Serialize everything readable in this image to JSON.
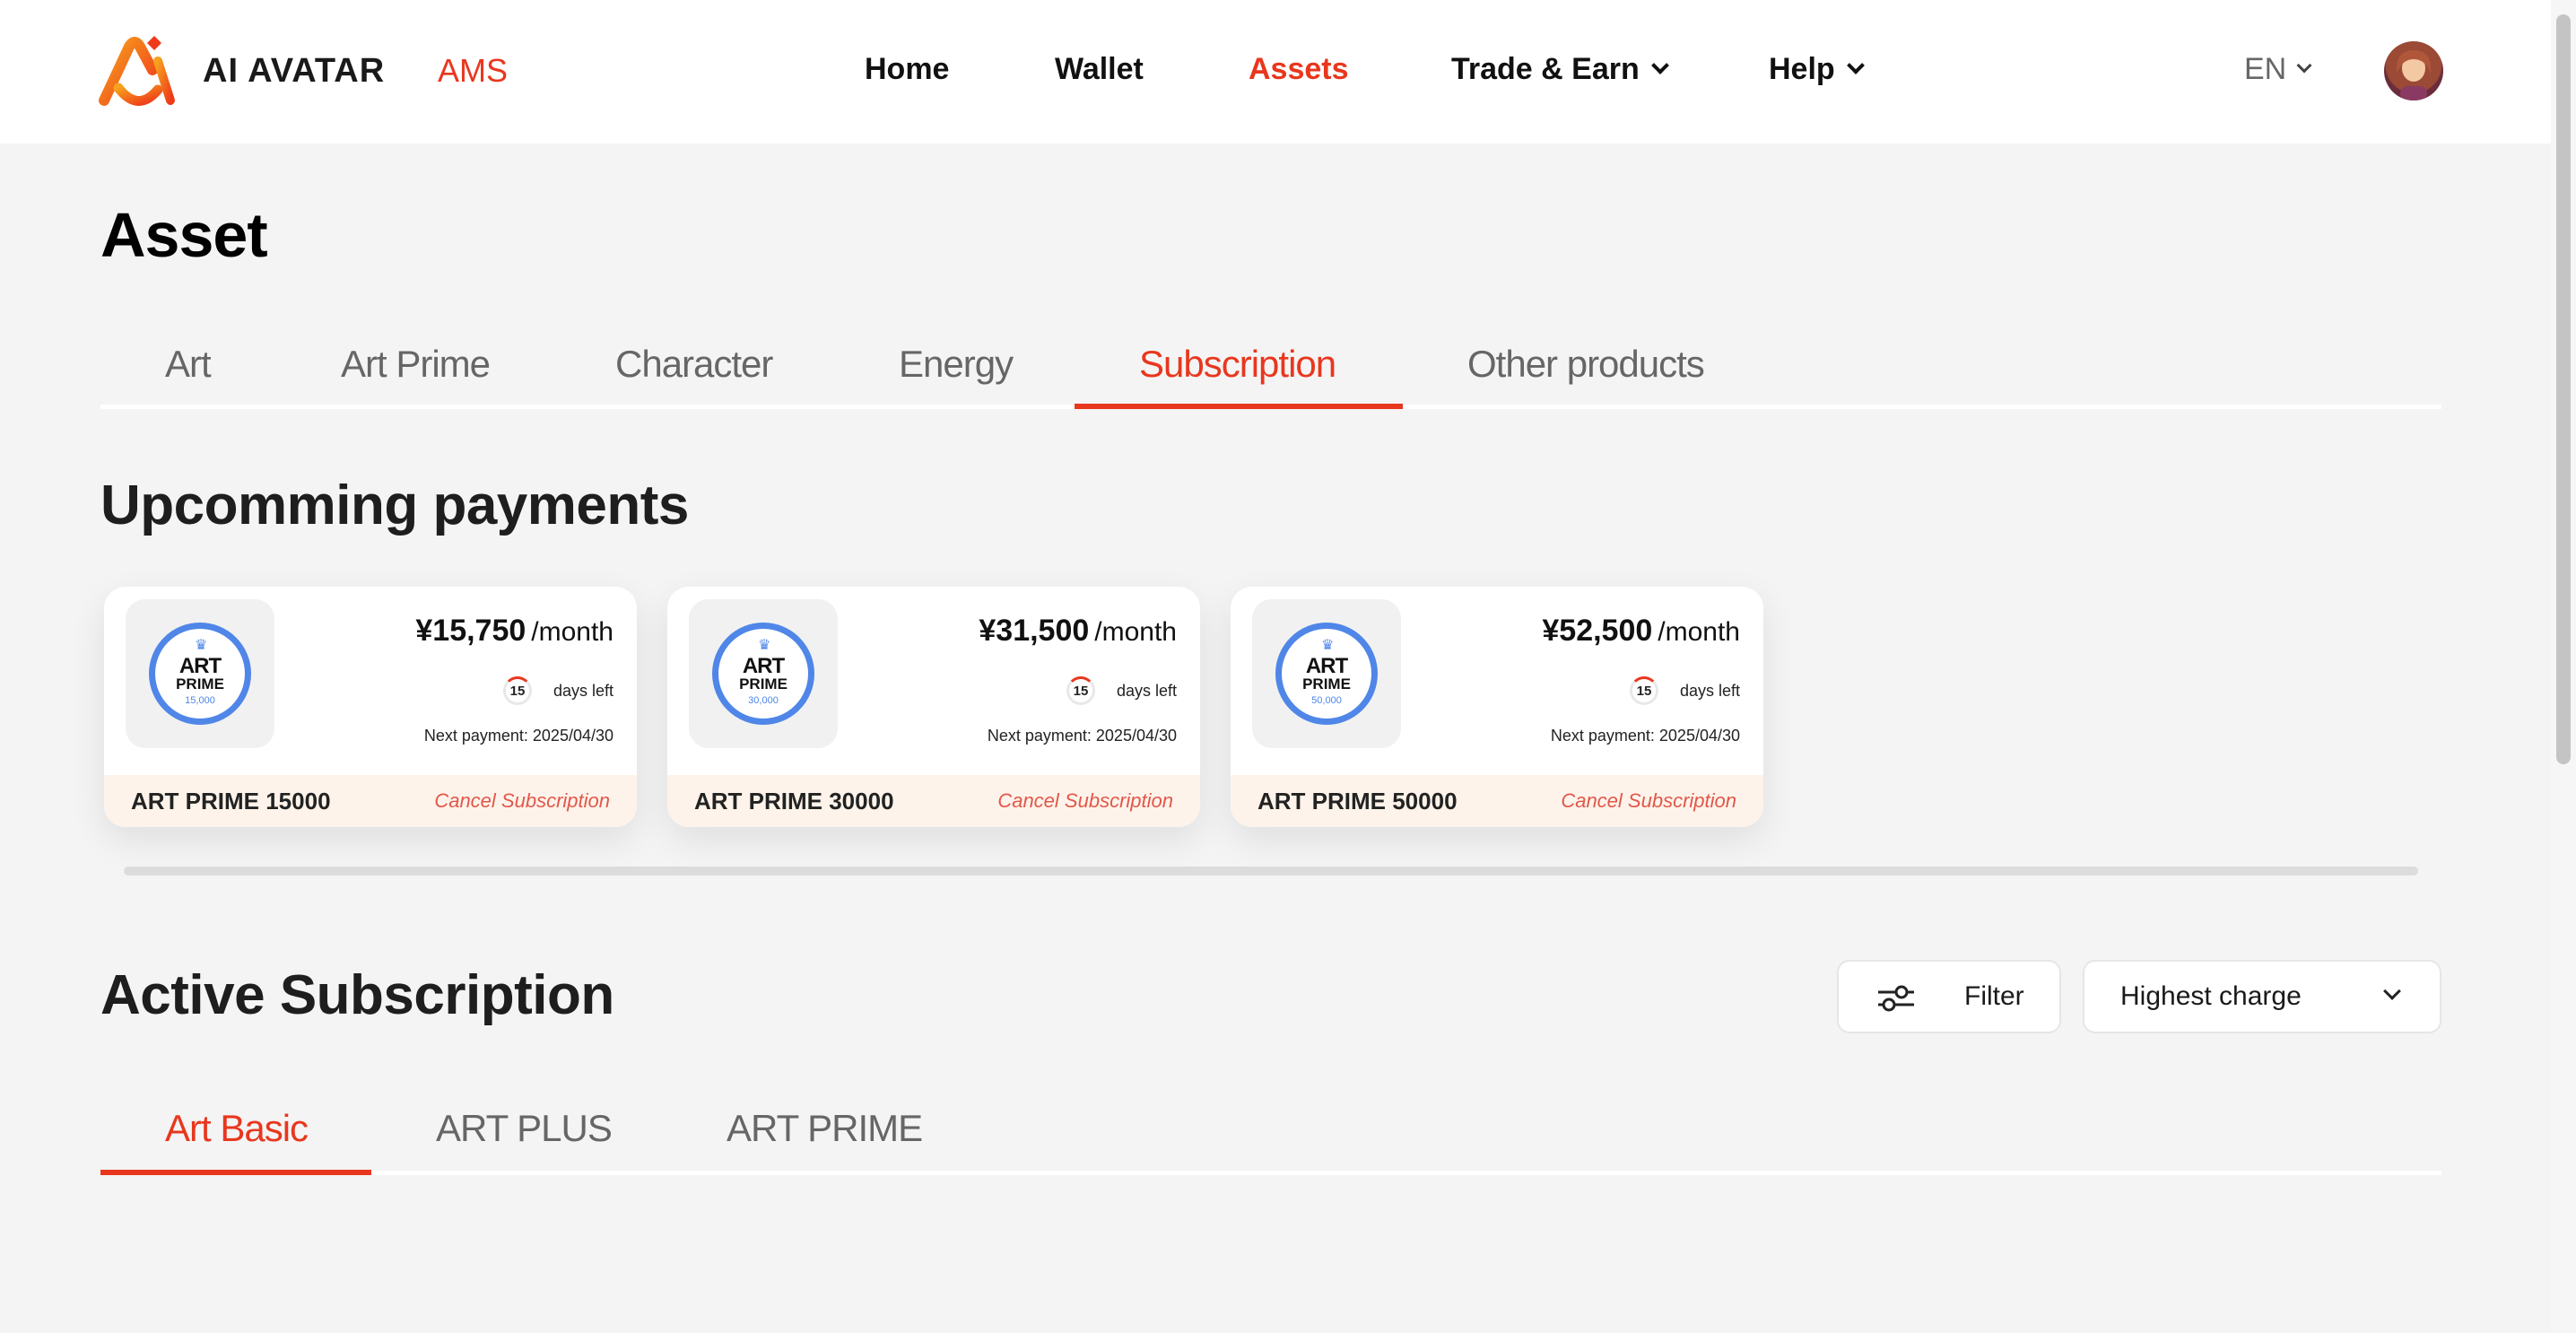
{
  "header": {
    "brand_name": "AI AVATAR",
    "brand_suffix": "AMS",
    "nav": [
      {
        "label": "Home"
      },
      {
        "label": "Wallet"
      },
      {
        "label": "Assets"
      },
      {
        "label": "Trade & Earn"
      },
      {
        "label": "Help"
      }
    ],
    "language": "EN"
  },
  "page": {
    "title": "Asset",
    "tabs": [
      "Art",
      "Art Prime",
      "Character",
      "Energy",
      "Subscription",
      "Other products"
    ],
    "active_tab": "Subscription"
  },
  "upcoming": {
    "title": "Upcomming payments",
    "cards": [
      {
        "badge_line1": "ART",
        "badge_line2": "PRIME",
        "badge_line3": "15,000",
        "amount": "¥15,750",
        "period": "/month",
        "days": "15",
        "days_label": "days left",
        "next_payment": "Next payment: 2025/04/30",
        "name": "ART PRIME 15000",
        "cancel_label": "Cancel Subscription"
      },
      {
        "badge_line1": "ART",
        "badge_line2": "PRIME",
        "badge_line3": "30,000",
        "amount": "¥31,500",
        "period": "/month",
        "days": "15",
        "days_label": "days left",
        "next_payment": "Next payment: 2025/04/30",
        "name": "ART PRIME 30000",
        "cancel_label": "Cancel Subscription"
      },
      {
        "badge_line1": "ART",
        "badge_line2": "PRIME",
        "badge_line3": "50,000",
        "amount": "¥52,500",
        "period": "/month",
        "days": "15",
        "days_label": "days left",
        "next_payment": "Next payment: 2025/04/30",
        "name": "ART PRIME 50000",
        "cancel_label": "Cancel Subscription"
      }
    ]
  },
  "active": {
    "title": "Active Subscription",
    "filter_label": "Filter",
    "sort_value": "Highest charge",
    "subtabs": [
      "Art Basic",
      "ART PLUS",
      "ART PRIME"
    ],
    "active_subtab": "Art Basic"
  },
  "colors": {
    "accent": "#e8371e",
    "badge_blue": "#4f86e8",
    "card_footer": "#fdf3ea",
    "background": "#f4f4f4"
  },
  "icons": {
    "logo": "ai-avatar-logo-icon",
    "nav_dropdown": "chevron-down-icon",
    "filter": "sliders-icon",
    "sort_dropdown": "chevron-down-icon",
    "crown": "crown-icon"
  }
}
